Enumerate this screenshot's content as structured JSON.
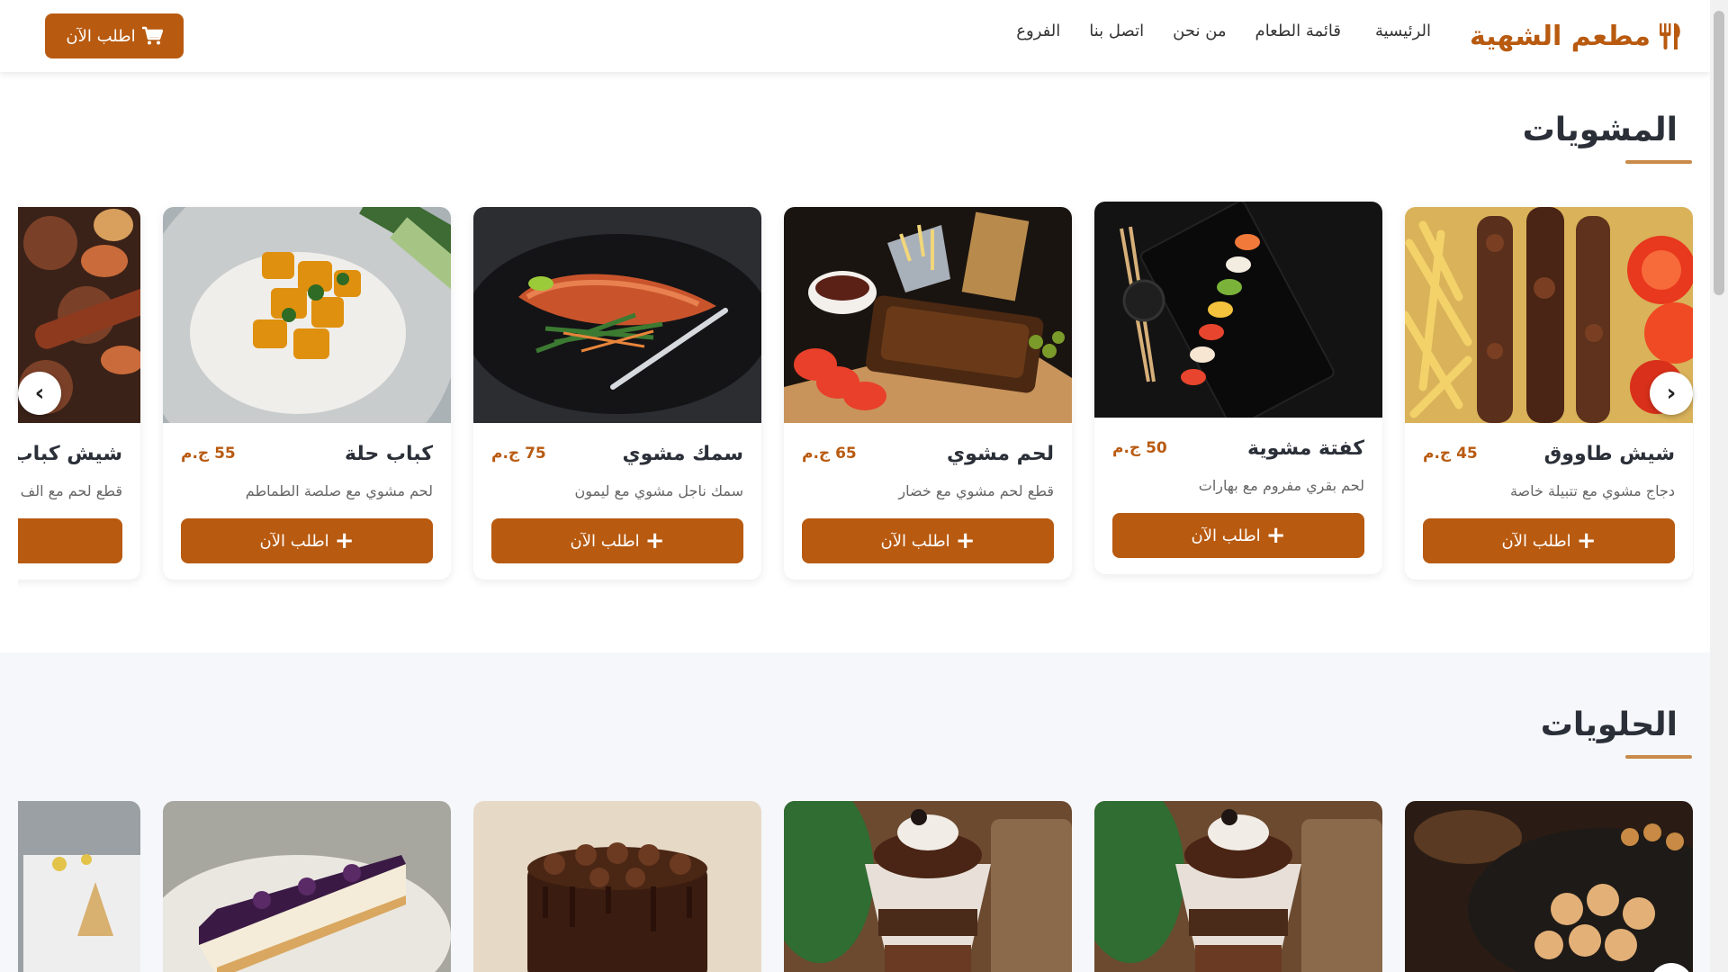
{
  "header": {
    "brand": "مطعم الشهية",
    "nav": [
      "الرئيسية",
      "قائمة الطعام",
      "من نحن",
      "اتصل بنا",
      "الفروع"
    ],
    "order_label": "اطلب الآن"
  },
  "grills": {
    "title": "المشويات",
    "items": [
      {
        "name": "شيش طاووق",
        "price": "45 ج.م",
        "desc": "دجاج مشوي مع تتبيلة خاصة",
        "button": "اطلب الآن"
      },
      {
        "name": "كفتة مشوية",
        "price": "50 ج.م",
        "desc": "لحم بقري مفروم مع بهارات",
        "button": "اطلب الآن"
      },
      {
        "name": "لحم مشوي",
        "price": "65 ج.م",
        "desc": "قطع لحم مشوي مع خضار",
        "button": "اطلب الآن"
      },
      {
        "name": "سمك مشوي",
        "price": "75 ج.م",
        "desc": "سمك ناجل مشوي مع ليمون",
        "button": "اطلب الآن"
      },
      {
        "name": "كباب حلة",
        "price": "55 ج.م",
        "desc": "لحم مشوي مع صلصة الطماطم",
        "button": "اطلب الآن"
      },
      {
        "name": "شيش كباب",
        "price": "",
        "desc": "قطع لحم مع الف",
        "button": ""
      }
    ]
  },
  "sweets": {
    "title": "الحلويات"
  },
  "colors": {
    "accent": "#b85a10",
    "underline": "#c98a4a",
    "title": "#2b2f38"
  }
}
